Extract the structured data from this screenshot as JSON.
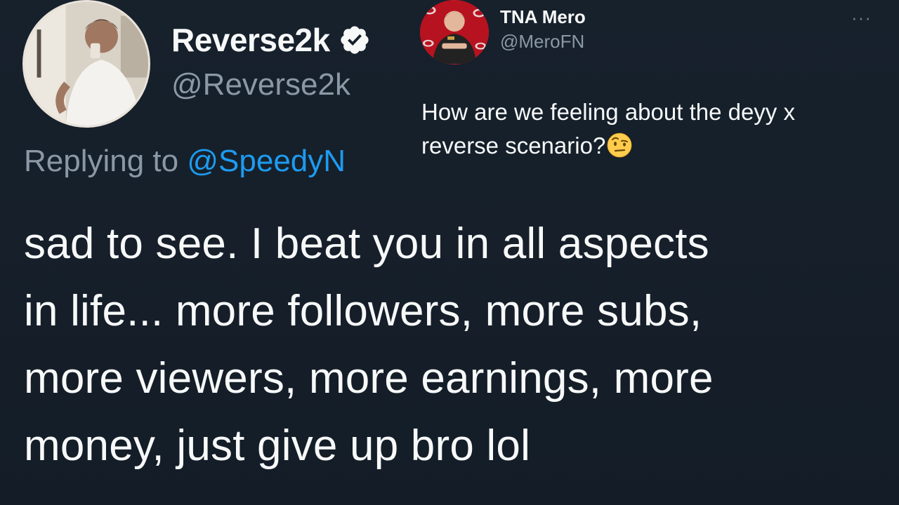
{
  "main_tweet": {
    "author_name": "Reverse2k",
    "author_handle": "@Reverse2k",
    "verified": true,
    "replying_prefix": "Replying to",
    "replying_mention": "@SpeedyN",
    "lines": [
      "sad to see. I beat you in all aspects",
      "in life... more followers, more subs,",
      "more viewers, more earnings, more",
      "money, just give up bro lol"
    ]
  },
  "quoted_tweet": {
    "author_name": "TNA Mero",
    "author_handle": "@MeroFN",
    "more_label": "···",
    "text_line_1": "How are we feeling about the deyy x",
    "text_line_2": "reverse scenario?",
    "emoji": "raised-eyebrow-face-icon"
  },
  "colors": {
    "background": "#15202b",
    "text_primary": "#f7f9f9",
    "text_secondary": "#8b98a5",
    "accent": "#1d9bf0"
  }
}
